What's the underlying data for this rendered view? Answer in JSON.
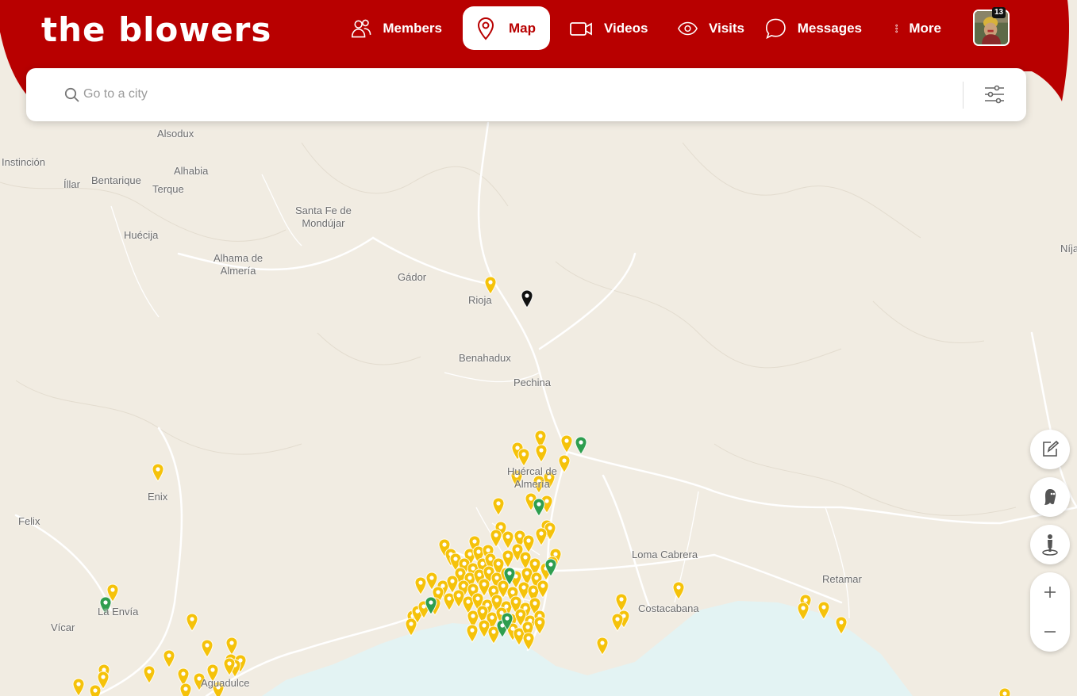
{
  "header": {
    "logo": "the blowers",
    "nav": [
      {
        "label": "Members",
        "icon": "members-icon",
        "active": false
      },
      {
        "label": "Map",
        "icon": "map-pin-icon",
        "active": true
      },
      {
        "label": "Videos",
        "icon": "video-camera-icon",
        "active": false
      },
      {
        "label": "Visits",
        "icon": "eye-icon",
        "active": false
      },
      {
        "label": "Messages",
        "icon": "chat-bubble-icon",
        "active": false
      },
      {
        "label": "More",
        "icon": "vertical-dots-icon",
        "active": false
      }
    ],
    "notification_count": "13",
    "brand_color": "#b80000"
  },
  "search": {
    "placeholder": "Go to a city",
    "value": ""
  },
  "map": {
    "places": [
      {
        "name": "Alsodux"
      },
      {
        "name": "Instinción"
      },
      {
        "name": "Alhabia"
      },
      {
        "name": "Íllar"
      },
      {
        "name": "Bentarique"
      },
      {
        "name": "Terque"
      },
      {
        "name": "Santa Fe de\nMondújar"
      },
      {
        "name": "Huécija"
      },
      {
        "name": "Alhama de\nAlmería"
      },
      {
        "name": "Gádor"
      },
      {
        "name": "Rioja"
      },
      {
        "name": "Benahadux"
      },
      {
        "name": "Pechina"
      },
      {
        "name": "Huércal de\nAlmería"
      },
      {
        "name": "Enix"
      },
      {
        "name": "Felix"
      },
      {
        "name": "La Envía"
      },
      {
        "name": "Vícar"
      },
      {
        "name": "Loma Cabrera"
      },
      {
        "name": "Costacabana"
      },
      {
        "name": "Retamar"
      },
      {
        "name": "Aguadulce"
      },
      {
        "name": "Níja"
      }
    ],
    "marker_colors": {
      "member": "#f5c20a",
      "online": "#2e9e4f",
      "self": "#111111"
    },
    "land_color": "#f1ece2",
    "sea_color": "#e3f3f3",
    "road_color": "#ffffff"
  },
  "controls": [
    {
      "name": "edit-button",
      "icon": "edit-icon"
    },
    {
      "name": "ghost-mode-button",
      "icon": "ghost-icon"
    },
    {
      "name": "street-view-button",
      "icon": "person-icon"
    },
    {
      "name": "zoom-in-button",
      "icon": "plus-icon"
    },
    {
      "name": "zoom-out-button",
      "icon": "minus-icon"
    }
  ]
}
